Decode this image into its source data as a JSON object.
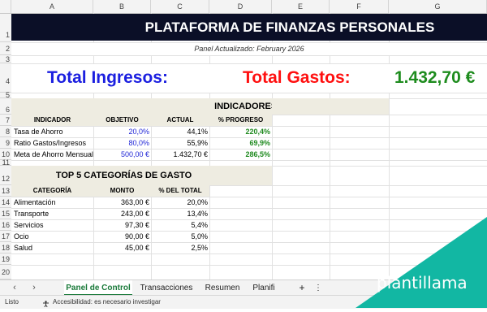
{
  "columns": [
    "A",
    "B",
    "C",
    "D",
    "E",
    "F",
    "G"
  ],
  "rows": [
    "1",
    "2",
    "3",
    "4",
    "5",
    "6",
    "7",
    "8",
    "9",
    "10",
    "11",
    "12",
    "13",
    "14",
    "15",
    "16",
    "17",
    "18",
    "19",
    "20"
  ],
  "header": {
    "title": "PLATAFORMA DE FINANZAS PERSONALES",
    "updated": "Panel Actualizado: February 2026"
  },
  "totals": {
    "income_label": "Total Ingresos:",
    "expense_label": "Total Gastos:",
    "balance": "1.432,70 €",
    "colors": {
      "income": "#1b1fe0",
      "expense": "#ff1010",
      "balance": "#1e8c1e"
    }
  },
  "indicators": {
    "title": "INDICADORES FINANCIEROS",
    "headers": [
      "INDICADOR",
      "OBJETIVO",
      "ACTUAL",
      "% PROGRESO"
    ],
    "rows": [
      {
        "name": "Tasa de Ahorro",
        "target": "20,0%",
        "actual": "44,1%",
        "progress": "220,4%"
      },
      {
        "name": "Ratio Gastos/Ingresos",
        "target": "80,0%",
        "actual": "55,9%",
        "progress": "69,9%"
      },
      {
        "name": "Meta de Ahorro Mensual",
        "target": "500,00 €",
        "actual": "1.432,70 €",
        "progress": "286,5%"
      }
    ]
  },
  "categories": {
    "title": "TOP 5 CATEGORÍAS DE GASTO",
    "headers": [
      "CATEGORÍA",
      "MONTO",
      "% DEL TOTAL"
    ],
    "rows": [
      {
        "name": "Alimentación",
        "amount": "363,00 €",
        "pct": "20,0%"
      },
      {
        "name": "Transporte",
        "amount": "243,00 €",
        "pct": "13,4%"
      },
      {
        "name": "Servicios",
        "amount": "97,30 €",
        "pct": "5,4%"
      },
      {
        "name": "Ocio",
        "amount": "90,00 €",
        "pct": "5,0%"
      },
      {
        "name": "Salud",
        "amount": "45,00 €",
        "pct": "2,5%"
      }
    ]
  },
  "tabs": {
    "items": [
      "Panel de Control",
      "Transacciones",
      "Resumen",
      "Planifi"
    ],
    "active": "Panel de Control",
    "add": "+",
    "more": "⋮"
  },
  "status": {
    "ready": "Listo",
    "accessibility": "Accesibilidad: es necesario investigar"
  },
  "brand": {
    "name": "plantillama",
    "color": "#12b7a3"
  }
}
